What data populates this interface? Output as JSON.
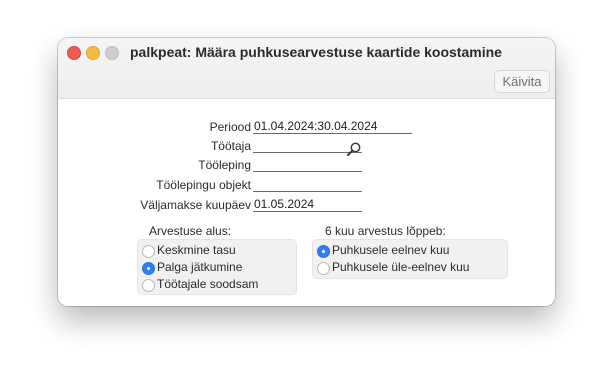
{
  "window": {
    "title": "palkpeat: Määra puhkusearvestuse kaartide koostamine",
    "run_button": "Käivita"
  },
  "fields": [
    {
      "label": "Periood",
      "value": "01.04.2024:30.04.2024"
    },
    {
      "label": "Töötaja",
      "value": ""
    },
    {
      "label": "Tööleping",
      "value": ""
    },
    {
      "label": "Töölepingu objekt",
      "value": ""
    },
    {
      "label": "Väljamakse kuupäev",
      "value": "01.05.2024"
    }
  ],
  "basis_group": {
    "title": "Arvestuse alus:",
    "options": [
      "Keskmine tasu",
      "Palga jätkumine",
      "Töötajale soodsam"
    ],
    "selected": "Palga jätkumine"
  },
  "end_group": {
    "title": "6 kuu arvestus lõppeb:",
    "options": [
      "Puhkusele eelnev kuu",
      "Puhkusele üle-eelnev kuu"
    ],
    "selected": "Puhkusele eelnev kuu"
  },
  "colors": {
    "accent": "#2f7ff3",
    "close": "#ee5b53",
    "minimize": "#f5bd3f",
    "maximize_disabled": "#cfcdce"
  }
}
